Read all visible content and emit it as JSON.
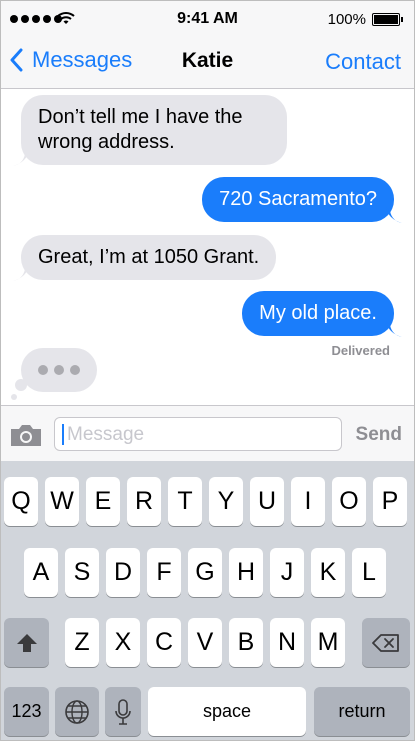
{
  "status_bar": {
    "time": "9:41 AM",
    "battery_percent": "100%",
    "signal_icon": "signal-dots-icon",
    "wifi_icon": "wifi-icon",
    "battery_icon": "battery-icon"
  },
  "nav": {
    "back_label": "Messages",
    "title": "Katie",
    "contact_label": "Contact"
  },
  "messages": [
    {
      "direction": "incoming",
      "text": "Don’t tell me I have the wrong address."
    },
    {
      "direction": "outgoing",
      "text": "720 Sacramento?"
    },
    {
      "direction": "incoming",
      "text": "Great, I’m at 1050 Grant."
    },
    {
      "direction": "outgoing",
      "text": "My old place."
    }
  ],
  "delivered_label": "Delivered",
  "typing_indicator": true,
  "composer": {
    "placeholder": "Message",
    "send_label": "Send",
    "camera_icon": "camera-icon"
  },
  "keyboard": {
    "row1": [
      "Q",
      "W",
      "E",
      "R",
      "T",
      "Y",
      "U",
      "I",
      "O",
      "P"
    ],
    "row2": [
      "A",
      "S",
      "D",
      "F",
      "G",
      "H",
      "J",
      "K",
      "L"
    ],
    "row3": [
      "Z",
      "X",
      "C",
      "V",
      "B",
      "N",
      "M"
    ],
    "numbers_label": "123",
    "space_label": "space",
    "return_label": "return",
    "shift_icon": "shift-arrow-icon",
    "delete_icon": "delete-backspace-icon",
    "globe_icon": "globe-icon",
    "mic_icon": "microphone-icon"
  },
  "colors": {
    "accent": "#1a7dfb",
    "incoming_bubble": "#e5e5ea",
    "keyboard_bg": "#d1d5db"
  }
}
